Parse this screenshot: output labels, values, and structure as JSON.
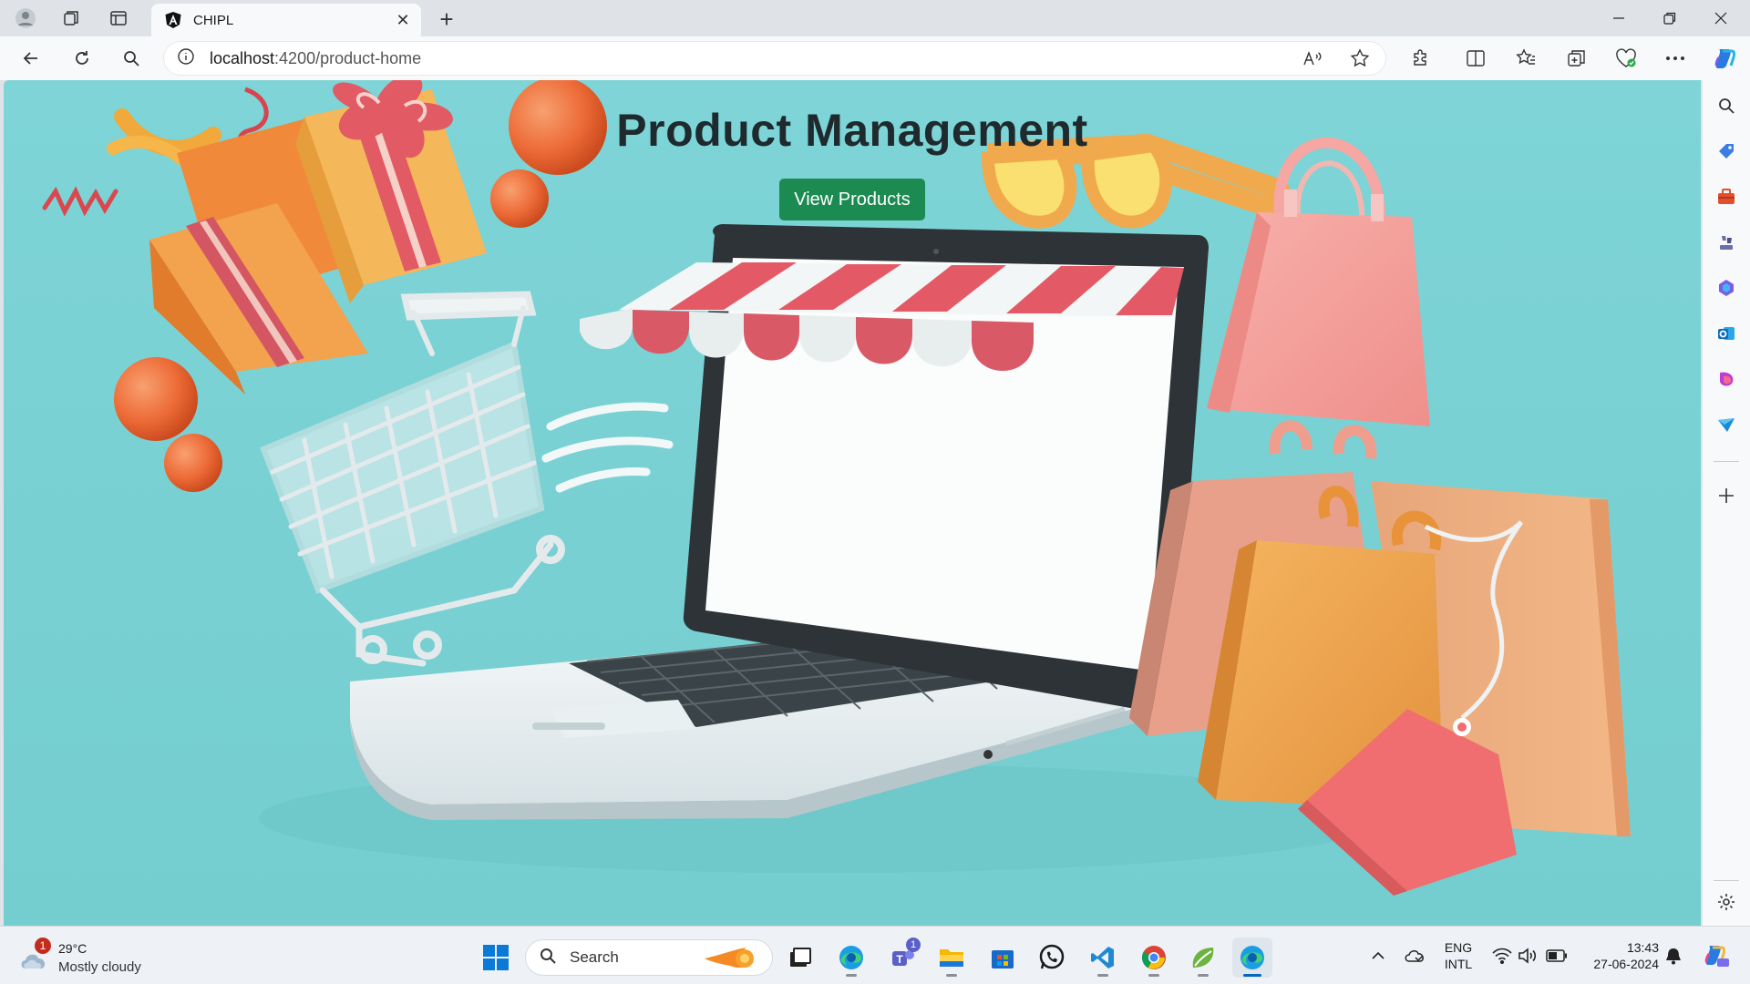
{
  "browser": {
    "tab": {
      "title": "CHIPL",
      "favicon": "angular-logo-icon"
    },
    "address": {
      "host": "localhost",
      "path": ":4200/product-home"
    }
  },
  "page": {
    "title": "Product Management",
    "button_label": "View Products"
  },
  "taskbar": {
    "weather": {
      "temp": "29°C",
      "desc": "Mostly cloudy",
      "badge": "1"
    },
    "search_placeholder": "Search",
    "teams_badge": "1",
    "lang_line1": "ENG",
    "lang_line2": "INTL",
    "time": "13:43",
    "date": "27-06-2024"
  },
  "colors": {
    "page_bg": "#7fd1d4",
    "button": "#1c8b52",
    "accent": "#0067c0"
  }
}
